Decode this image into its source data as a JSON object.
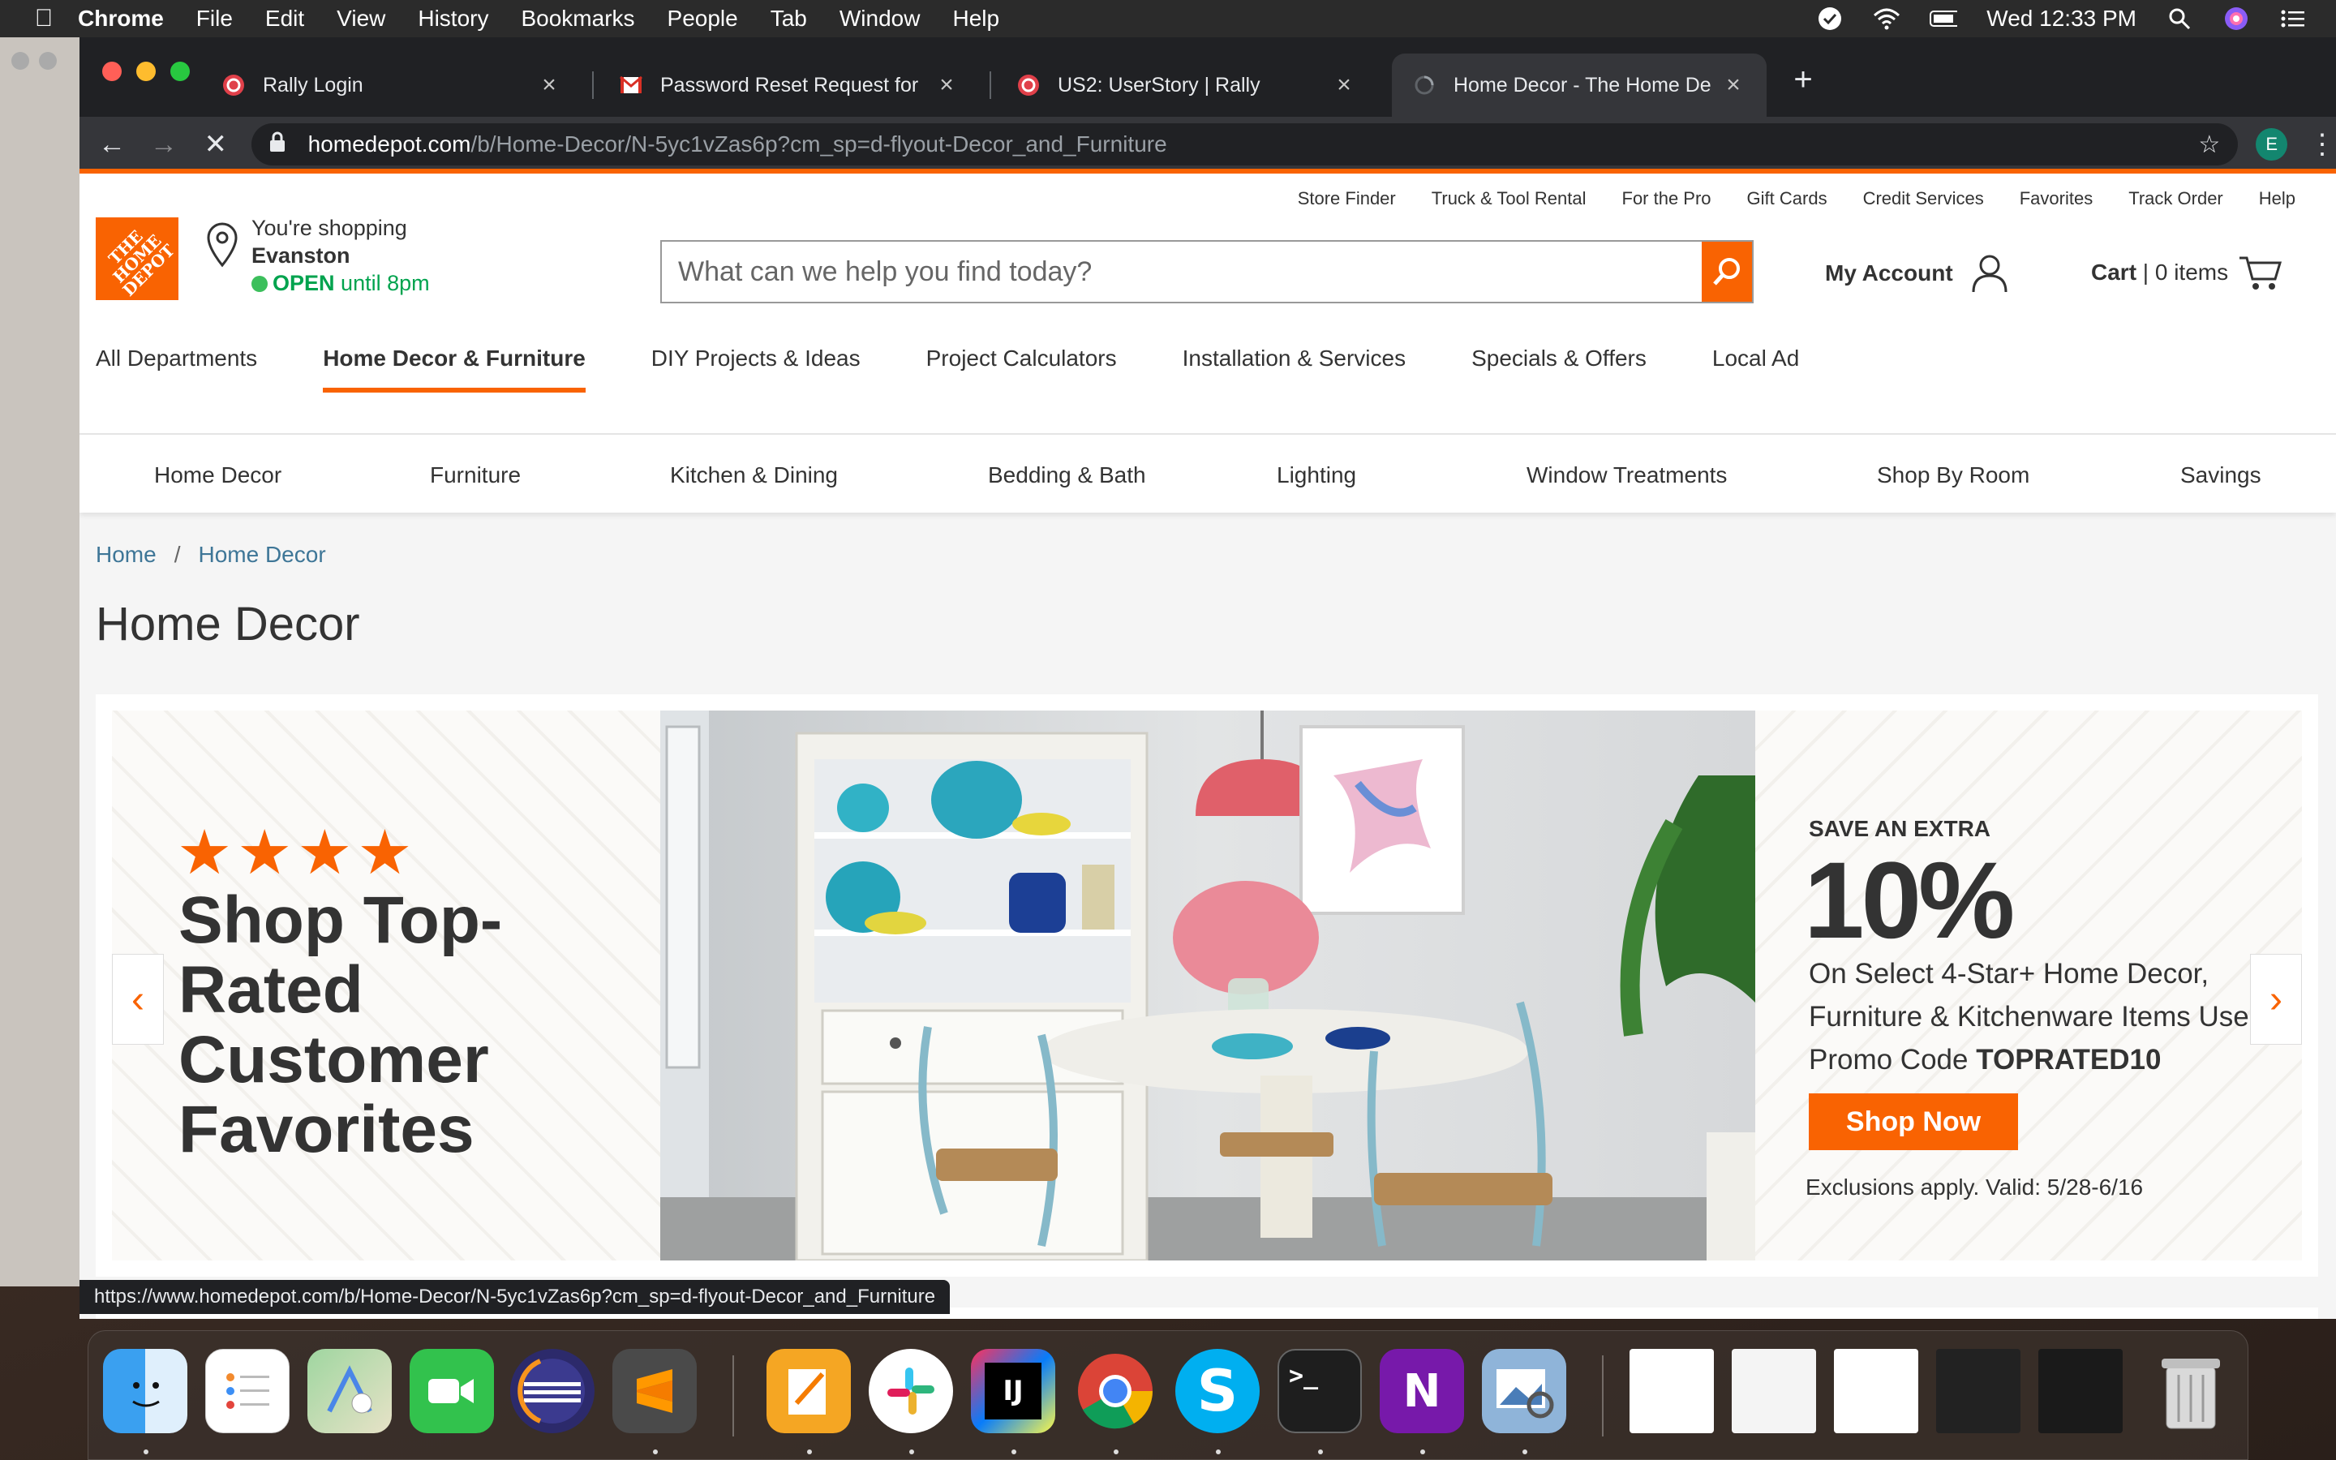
{
  "menubar": {
    "app_name": "Chrome",
    "items": [
      "File",
      "Edit",
      "View",
      "History",
      "Bookmarks",
      "People",
      "Tab",
      "Window",
      "Help"
    ],
    "clock": "Wed 12:33 PM"
  },
  "tabs": [
    {
      "title": "Rally Login",
      "favicon": "rally-icon"
    },
    {
      "title": "Password Reset Request for CA",
      "favicon": "gmail-icon"
    },
    {
      "title": "US2: UserStory | Rally",
      "favicon": "rally-icon"
    },
    {
      "title": "Home Decor - The Home Depot",
      "favicon": "loading-icon"
    }
  ],
  "omnibox": {
    "host": "homedepot.com",
    "path": "/b/Home-Decor/N-5yc1vZas6p?cm_sp=d-flyout-Decor_and_Furniture"
  },
  "profile_initial": "E",
  "header": {
    "utility_links": [
      "Store Finder",
      "Truck & Tool Rental",
      "For the Pro",
      "Gift Cards",
      "Credit Services",
      "Favorites",
      "Track Order",
      "Help"
    ],
    "logo_text": "THE HOME DEPOT",
    "store": {
      "prefix": "You're shopping",
      "city": "Evanston",
      "open": "OPEN",
      "hours": "until 8pm"
    },
    "search_placeholder": "What can we help you find today?",
    "account_label": "My Account",
    "cart_label": "Cart",
    "cart_count": "0 items"
  },
  "primary_nav": [
    "All Departments",
    "Home Decor & Furniture",
    "DIY Projects & Ideas",
    "Project Calculators",
    "Installation & Services",
    "Specials & Offers",
    "Local Ad"
  ],
  "sub_nav": [
    "Home Decor",
    "Furniture",
    "Kitchen & Dining",
    "Bedding & Bath",
    "Lighting",
    "Window Treatments",
    "Shop By Room",
    "Savings"
  ],
  "breadcrumb": [
    "Home",
    "Home Decor"
  ],
  "page_title": "Home Decor",
  "banner": {
    "stars": "★★★★",
    "headline": "Shop Top-Rated Customer Favorites",
    "save_extra": "SAVE AN EXTRA",
    "percent": "10%",
    "offer_line": "On Select 4-Star+ Home Decor, Furniture & Kitchenware Items Use Promo Code",
    "promo_code": "TOPRATED10",
    "cta": "Shop Now",
    "exclusions": "Exclusions apply. Valid: 5/28-6/16"
  },
  "status_url": "https://www.homedepot.com/b/Home-Decor/N-5yc1vZas6p?cm_sp=d-flyout-Decor_and_Furniture",
  "colors": {
    "brand_orange": "#f96302",
    "open_green": "#00a34e",
    "link_blue": "#3e7697"
  },
  "dock": [
    "finder-icon",
    "reminders-icon",
    "maps-icon",
    "facetime-icon",
    "eclipse-icon",
    "sublime-text-icon",
    "pages-icon",
    "slack-icon",
    "intellij-icon",
    "chrome-icon",
    "skype-icon",
    "terminal-icon",
    "onenote-icon",
    "preview-icon",
    "trash-icon"
  ]
}
